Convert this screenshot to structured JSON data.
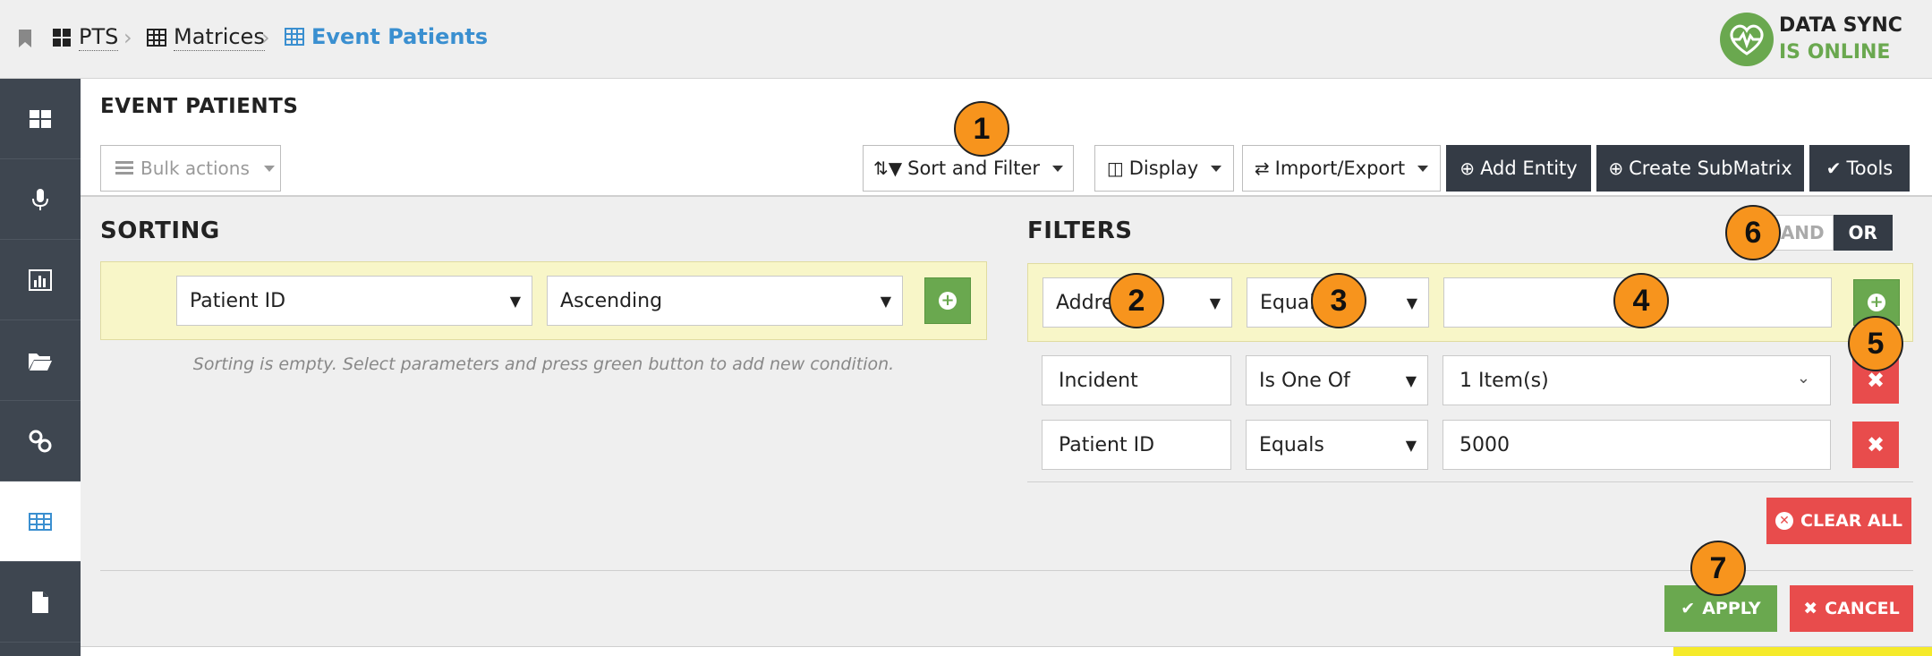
{
  "breadcrumb": [
    {
      "label": "PTS",
      "icon": "grid-icon"
    },
    {
      "label": "Matrices",
      "icon": "table-icon"
    },
    {
      "label": "Event Patients",
      "icon": "table-icon"
    }
  ],
  "sync": {
    "line1": "DATA SYNC",
    "line2": "IS ONLINE"
  },
  "sidebar": {
    "items": [
      "dashboard-icon",
      "microphone-icon",
      "chart-icon",
      "folder-icon",
      "link-icon",
      "table-icon",
      "document-icon"
    ],
    "active": "table-icon"
  },
  "page": {
    "title": "EVENT PATIENTS"
  },
  "toolbar": {
    "bulk_actions": "Bulk actions",
    "sort_filter": "Sort and Filter",
    "display": "Display",
    "import_export": "Import/Export",
    "add_entity": "Add Entity",
    "create_submatrix": "Create SubMatrix",
    "tools": "Tools"
  },
  "sorting": {
    "title": "SORTING",
    "field": "Patient ID",
    "order": "Ascending",
    "empty_message": "Sorting is empty. Select parameters and press green button to add new condition."
  },
  "filters": {
    "title": "FILTERS",
    "logic": {
      "and": "AND",
      "or": "OR",
      "selected": "OR"
    },
    "new_row": {
      "field": "Addre",
      "operator": "Equals",
      "value": ""
    },
    "rows": [
      {
        "field": "Incident",
        "operator": "Is One Of",
        "value": "1 Item(s)"
      },
      {
        "field": "Patient ID",
        "operator": "Equals",
        "value": "5000"
      }
    ],
    "clear_all": "CLEAR ALL"
  },
  "actions": {
    "apply": "APPLY",
    "cancel": "CANCEL"
  },
  "annotations": [
    "1",
    "2",
    "3",
    "4",
    "5",
    "6",
    "7"
  ],
  "colors": {
    "accent_blue": "#3a8fd0",
    "green": "#6aa84f",
    "red": "#e84c4c",
    "dark": "#343b45",
    "badge": "#f7941d"
  }
}
